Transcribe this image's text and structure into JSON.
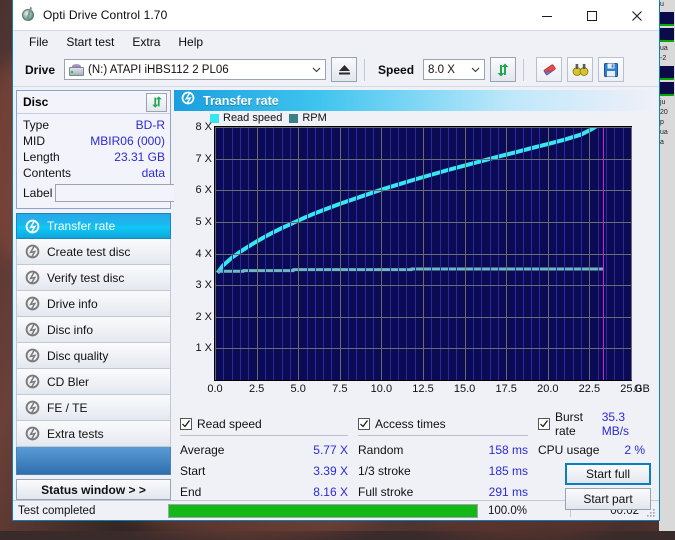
{
  "window": {
    "title": "Opti Drive Control 1.70",
    "app_icon": "disc-drive-icon",
    "controls": {
      "minimize": "minimize-icon",
      "maximize": "maximize-icon",
      "close": "close-icon"
    }
  },
  "menubar": {
    "items": [
      "File",
      "Start test",
      "Extra",
      "Help"
    ]
  },
  "toolbar": {
    "drive_label": "Drive",
    "drive_value": "(N:)  ATAPI iHBS112  2 PL06",
    "eject_icon": "eject-icon",
    "speed_label": "Speed",
    "speed_value": "8.0 X",
    "refresh_icon": "refresh-icon",
    "eraser_icon": "eraser-icon",
    "binoculars_icon": "binoculars-icon",
    "save_icon": "save-icon"
  },
  "disc": {
    "panel_title": "Disc",
    "refresh_icon": "refresh-icon",
    "rows": [
      {
        "key": "Type",
        "value": "BD-R"
      },
      {
        "key": "MID",
        "value": "MBIR06 (000)"
      },
      {
        "key": "Length",
        "value": "23.31 GB"
      },
      {
        "key": "Contents",
        "value": "data"
      }
    ],
    "label_key": "Label",
    "label_value": "",
    "label_placeholder": "",
    "disc_icon": "compact-disc-icon"
  },
  "nav": {
    "items": [
      {
        "label": "Transfer rate",
        "icon": "disc-test-icon",
        "active": true
      },
      {
        "label": "Create test disc",
        "icon": "disc-test-icon",
        "active": false
      },
      {
        "label": "Verify test disc",
        "icon": "disc-test-icon",
        "active": false
      },
      {
        "label": "Drive info",
        "icon": "disc-test-icon",
        "active": false
      },
      {
        "label": "Disc info",
        "icon": "disc-test-icon",
        "active": false
      },
      {
        "label": "Disc quality",
        "icon": "disc-test-icon",
        "active": false
      },
      {
        "label": "CD Bler",
        "icon": "disc-test-icon",
        "active": false
      },
      {
        "label": "FE / TE",
        "icon": "disc-test-icon",
        "active": false
      },
      {
        "label": "Extra tests",
        "icon": "disc-test-icon",
        "active": false
      }
    ],
    "status_window_button": "Status window > >"
  },
  "panel": {
    "header_title": "Transfer rate",
    "header_icon": "disc-test-icon"
  },
  "chart_data": {
    "type": "line",
    "title": "Transfer rate",
    "xlabel": "GB",
    "ylabel": "X",
    "xlim": [
      0,
      25.0
    ],
    "ylim": [
      0,
      8
    ],
    "grid": true,
    "legend_position": "top-left",
    "x_unit": "GB",
    "x_ticks": [
      "0.0",
      "2.5",
      "5.0",
      "7.5",
      "10.0",
      "12.5",
      "15.0",
      "17.5",
      "20.0",
      "22.5",
      "25.0"
    ],
    "x_tick_values": [
      0,
      2.5,
      5.0,
      7.5,
      10.0,
      12.5,
      15.0,
      17.5,
      20.0,
      22.5,
      25.0
    ],
    "y_ticks": [
      "1 X",
      "2 X",
      "3 X",
      "4 X",
      "5 X",
      "6 X",
      "7 X",
      "8 X"
    ],
    "y_tick_values": [
      1,
      2,
      3,
      4,
      5,
      6,
      7,
      8
    ],
    "marker_x": 23.31,
    "marker_color": "#d020d0",
    "plot_bg": "#0b0b55",
    "series": [
      {
        "name": "Read speed",
        "color": "#35e8f0",
        "x": [
          0.15,
          0.5,
          1.0,
          1.5,
          2.0,
          2.5,
          3.0,
          3.5,
          4.0,
          4.5,
          5.0,
          5.5,
          6.0,
          6.5,
          7.0,
          7.5,
          8.0,
          9.0,
          10.0,
          11.0,
          12.0,
          13.0,
          14.0,
          15.0,
          16.0,
          17.0,
          18.0,
          19.0,
          20.0,
          21.0,
          22.0,
          22.6,
          23.0,
          23.31
        ],
        "values": [
          3.39,
          3.63,
          3.86,
          4.05,
          4.22,
          4.38,
          4.53,
          4.67,
          4.8,
          4.92,
          5.04,
          5.16,
          5.27,
          5.37,
          5.47,
          5.57,
          5.66,
          5.84,
          6.02,
          6.18,
          6.34,
          6.49,
          6.64,
          6.78,
          6.92,
          7.06,
          7.19,
          7.33,
          7.46,
          7.6,
          7.76,
          7.92,
          8.05,
          8.16
        ]
      },
      {
        "name": "RPM",
        "color": "#6fb8c0",
        "x": [
          0.15,
          1.7,
          1.72,
          4.7,
          4.72,
          11.8,
          11.82,
          23.31
        ],
        "values": [
          3.44,
          3.44,
          3.46,
          3.46,
          3.49,
          3.49,
          3.51,
          3.51
        ]
      }
    ]
  },
  "stats": {
    "columns": [
      {
        "checkbox_label": "Read speed",
        "checked": true,
        "extra_value": "",
        "rows": [
          {
            "key": "Average",
            "value": "5.77 X"
          },
          {
            "key": "Start",
            "value": "3.39 X"
          },
          {
            "key": "End",
            "value": "8.16 X"
          }
        ]
      },
      {
        "checkbox_label": "Access times",
        "checked": true,
        "extra_value": "",
        "rows": [
          {
            "key": "Random",
            "value": "158 ms"
          },
          {
            "key": "1/3 stroke",
            "value": "185 ms"
          },
          {
            "key": "Full stroke",
            "value": "291 ms"
          }
        ]
      },
      {
        "checkbox_label": "Burst rate",
        "checked": true,
        "extra_value": "35.3 MB/s",
        "rows": [
          {
            "key": "CPU usage",
            "value": "2 %"
          }
        ]
      }
    ],
    "start_full_button": "Start full",
    "start_part_button": "Start part"
  },
  "statusbar": {
    "text": "Test completed",
    "progress_percent": "100.0%",
    "progress_value": 100,
    "elapsed": "00:02",
    "grip_icon": "resize-grip-icon"
  },
  "colors": {
    "accent": "#0a7fc0",
    "value_blue": "#2b2bd6",
    "read_speed": "#35e8f0",
    "rpm": "#3d7f88",
    "progress_green": "#14b814",
    "marker_magenta": "#d020d0"
  }
}
